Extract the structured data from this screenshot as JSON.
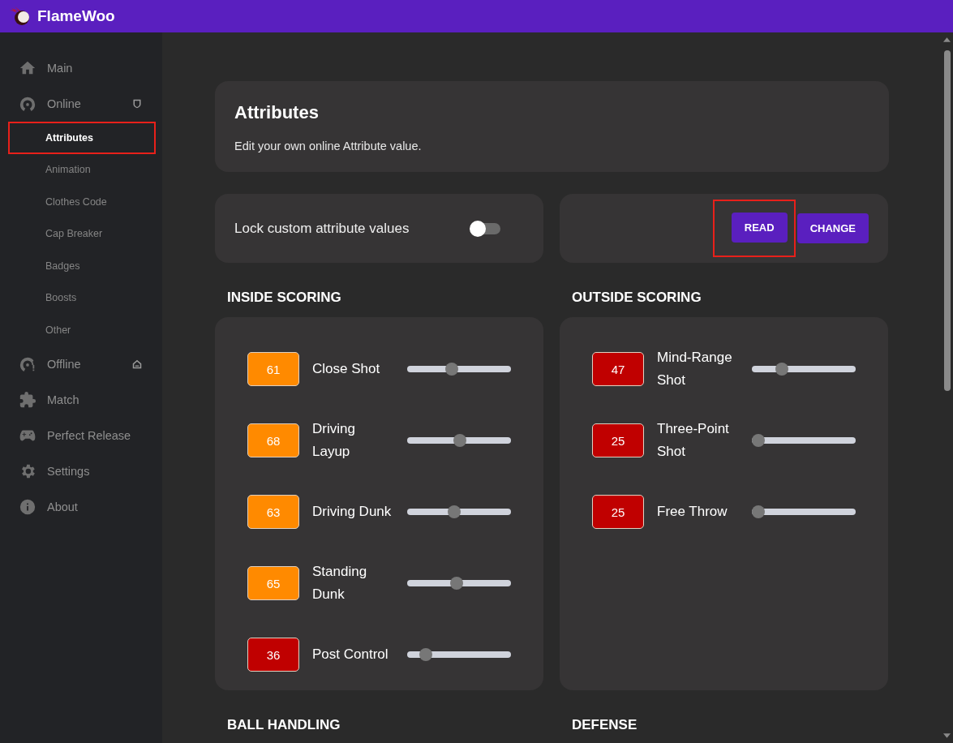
{
  "app": {
    "title": "FlameWoo"
  },
  "sidebar": {
    "items": [
      {
        "label": "Main",
        "selected": false
      },
      {
        "label": "Online",
        "selected": false,
        "children": [
          {
            "label": "Attributes",
            "selected": true,
            "highlighted": true
          },
          {
            "label": "Animation",
            "selected": false,
            "highlighted": false
          },
          {
            "label": "Clothes Code",
            "selected": false,
            "highlighted": false
          },
          {
            "label": "Cap Breaker",
            "selected": false,
            "highlighted": false
          },
          {
            "label": "Badges",
            "selected": false,
            "highlighted": false
          },
          {
            "label": "Boosts",
            "selected": false,
            "highlighted": false
          },
          {
            "label": "Other",
            "selected": false,
            "highlighted": false
          }
        ]
      },
      {
        "label": "Offline",
        "selected": false
      },
      {
        "label": "Match",
        "selected": false
      },
      {
        "label": "Perfect Release",
        "selected": false
      },
      {
        "label": "Settings",
        "selected": false
      },
      {
        "label": "About",
        "selected": false
      }
    ]
  },
  "header_card": {
    "title": "Attributes",
    "description": "Edit your own online Attribute value."
  },
  "lock_toggle": {
    "label": "Lock custom attribute values",
    "on": false
  },
  "buttons": [
    {
      "label": "READ",
      "highlighted": true
    },
    {
      "label": "CHANGE",
      "highlighted": false
    }
  ],
  "sections": [
    {
      "title": "INSIDE SCORING",
      "attributes": [
        {
          "value": "61",
          "name": "Close Shot",
          "color": "#ff8a00",
          "level": 0.42
        },
        {
          "value": "68",
          "name": "Driving Layup",
          "color": "#ff8a00",
          "level": 0.51
        },
        {
          "value": "63",
          "name": "Driving Dunk",
          "color": "#ff8a00",
          "level": 0.45
        },
        {
          "value": "65",
          "name": "Standing Dunk",
          "color": "#ff8a00",
          "level": 0.47
        },
        {
          "value": "36",
          "name": "Post Control",
          "color": "#c00000",
          "level": 0.13
        }
      ]
    },
    {
      "title": "OUTSIDE SCORING",
      "attributes": [
        {
          "value": "47",
          "name": "Mind-Range Shot",
          "color": "#c00000",
          "level": 0.26
        },
        {
          "value": "25",
          "name": "Three-Point Shot",
          "color": "#c00000",
          "level": 0
        },
        {
          "value": "25",
          "name": "Free Throw",
          "color": "#c00000",
          "level": 0
        }
      ]
    },
    {
      "title": "BALL HANDLING"
    },
    {
      "title": "DEFENSE"
    }
  ]
}
